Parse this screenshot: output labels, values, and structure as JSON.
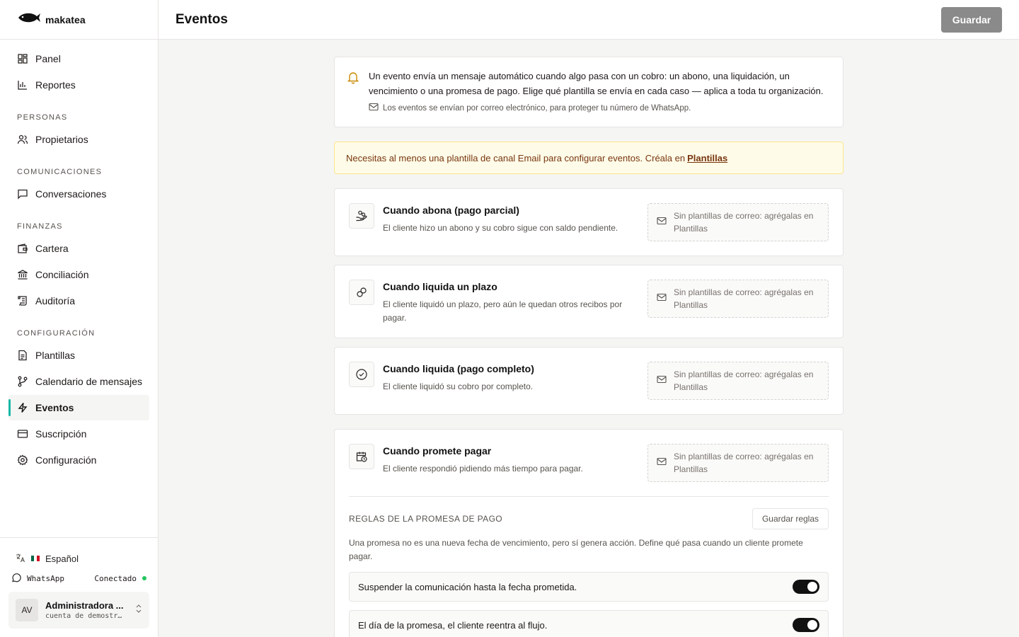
{
  "brand": {
    "name": "makatea"
  },
  "header": {
    "title": "Eventos",
    "save_label": "Guardar"
  },
  "nav": {
    "panel": "Panel",
    "reportes": "Reportes",
    "section_personas": "PERSONAS",
    "propietarios": "Propietarios",
    "section_comunicaciones": "COMUNICACIONES",
    "conversaciones": "Conversaciones",
    "section_finanzas": "FINANZAS",
    "cartera": "Cartera",
    "conciliacion": "Conciliación",
    "auditoria": "Auditoría",
    "section_configuracion": "CONFIGURACIÓN",
    "plantillas": "Plantillas",
    "calendario": "Calendario de mensajes",
    "eventos": "Eventos",
    "suscripcion": "Suscripción",
    "configuracion": "Configuración",
    "active": "eventos",
    "accent_color": "#14b8a6"
  },
  "footer": {
    "language": "Español",
    "whatsapp_label": "WhatsApp",
    "whatsapp_status": "Conectado",
    "user_initials": "AV",
    "user_name": "Administradora ...",
    "user_sub": "cuenta de demostr…"
  },
  "info": {
    "text": "Un evento envía un mensaje automático cuando algo pasa con un cobro: un abono, una liquidación, un vencimiento o una promesa de pago. Elige qué plantilla se envía en cada caso — aplica a toda tu organización.",
    "note": "Los eventos se envían por correo electrónico, para proteger tu número de WhatsApp."
  },
  "warning": {
    "text": "Necesitas al menos una plantilla de canal Email para configurar eventos. Créala en",
    "link": "Plantillas"
  },
  "events": [
    {
      "title": "Cuando abona (pago parcial)",
      "desc": "El cliente hizo un abono y su cobro sigue con saldo pendiente.",
      "template": "Sin plantillas de correo: agrégalas en Plantillas",
      "icon": "coins-hand-icon"
    },
    {
      "title": "Cuando liquida un plazo",
      "desc": "El cliente liquidó un plazo, pero aún le quedan otros recibos por pagar.",
      "template": "Sin plantillas de correo: agrégalas en Plantillas",
      "icon": "link-icon"
    },
    {
      "title": "Cuando liquida (pago completo)",
      "desc": "El cliente liquidó su cobro por completo.",
      "template": "Sin plantillas de correo: agrégalas en Plantillas",
      "icon": "check-circle-icon"
    },
    {
      "title": "Cuando promete pagar",
      "desc": "El cliente respondió pidiendo más tiempo para pagar.",
      "template": "Sin plantillas de correo: agrégalas en Plantillas",
      "icon": "calendar-clock-icon"
    }
  ],
  "rules": {
    "title": "REGLAS DE LA PROMESA DE PAGO",
    "save_label": "Guardar reglas",
    "desc": "Una promesa no es una nueva fecha de vencimiento, pero sí genera acción. Define qué pasa cuando un cliente promete pagar.",
    "toggles": [
      {
        "label": "Suspender la comunicación hasta la fecha prometida.",
        "on": true
      },
      {
        "label": "El día de la promesa, el cliente reentra al flujo.",
        "on": true
      }
    ]
  }
}
